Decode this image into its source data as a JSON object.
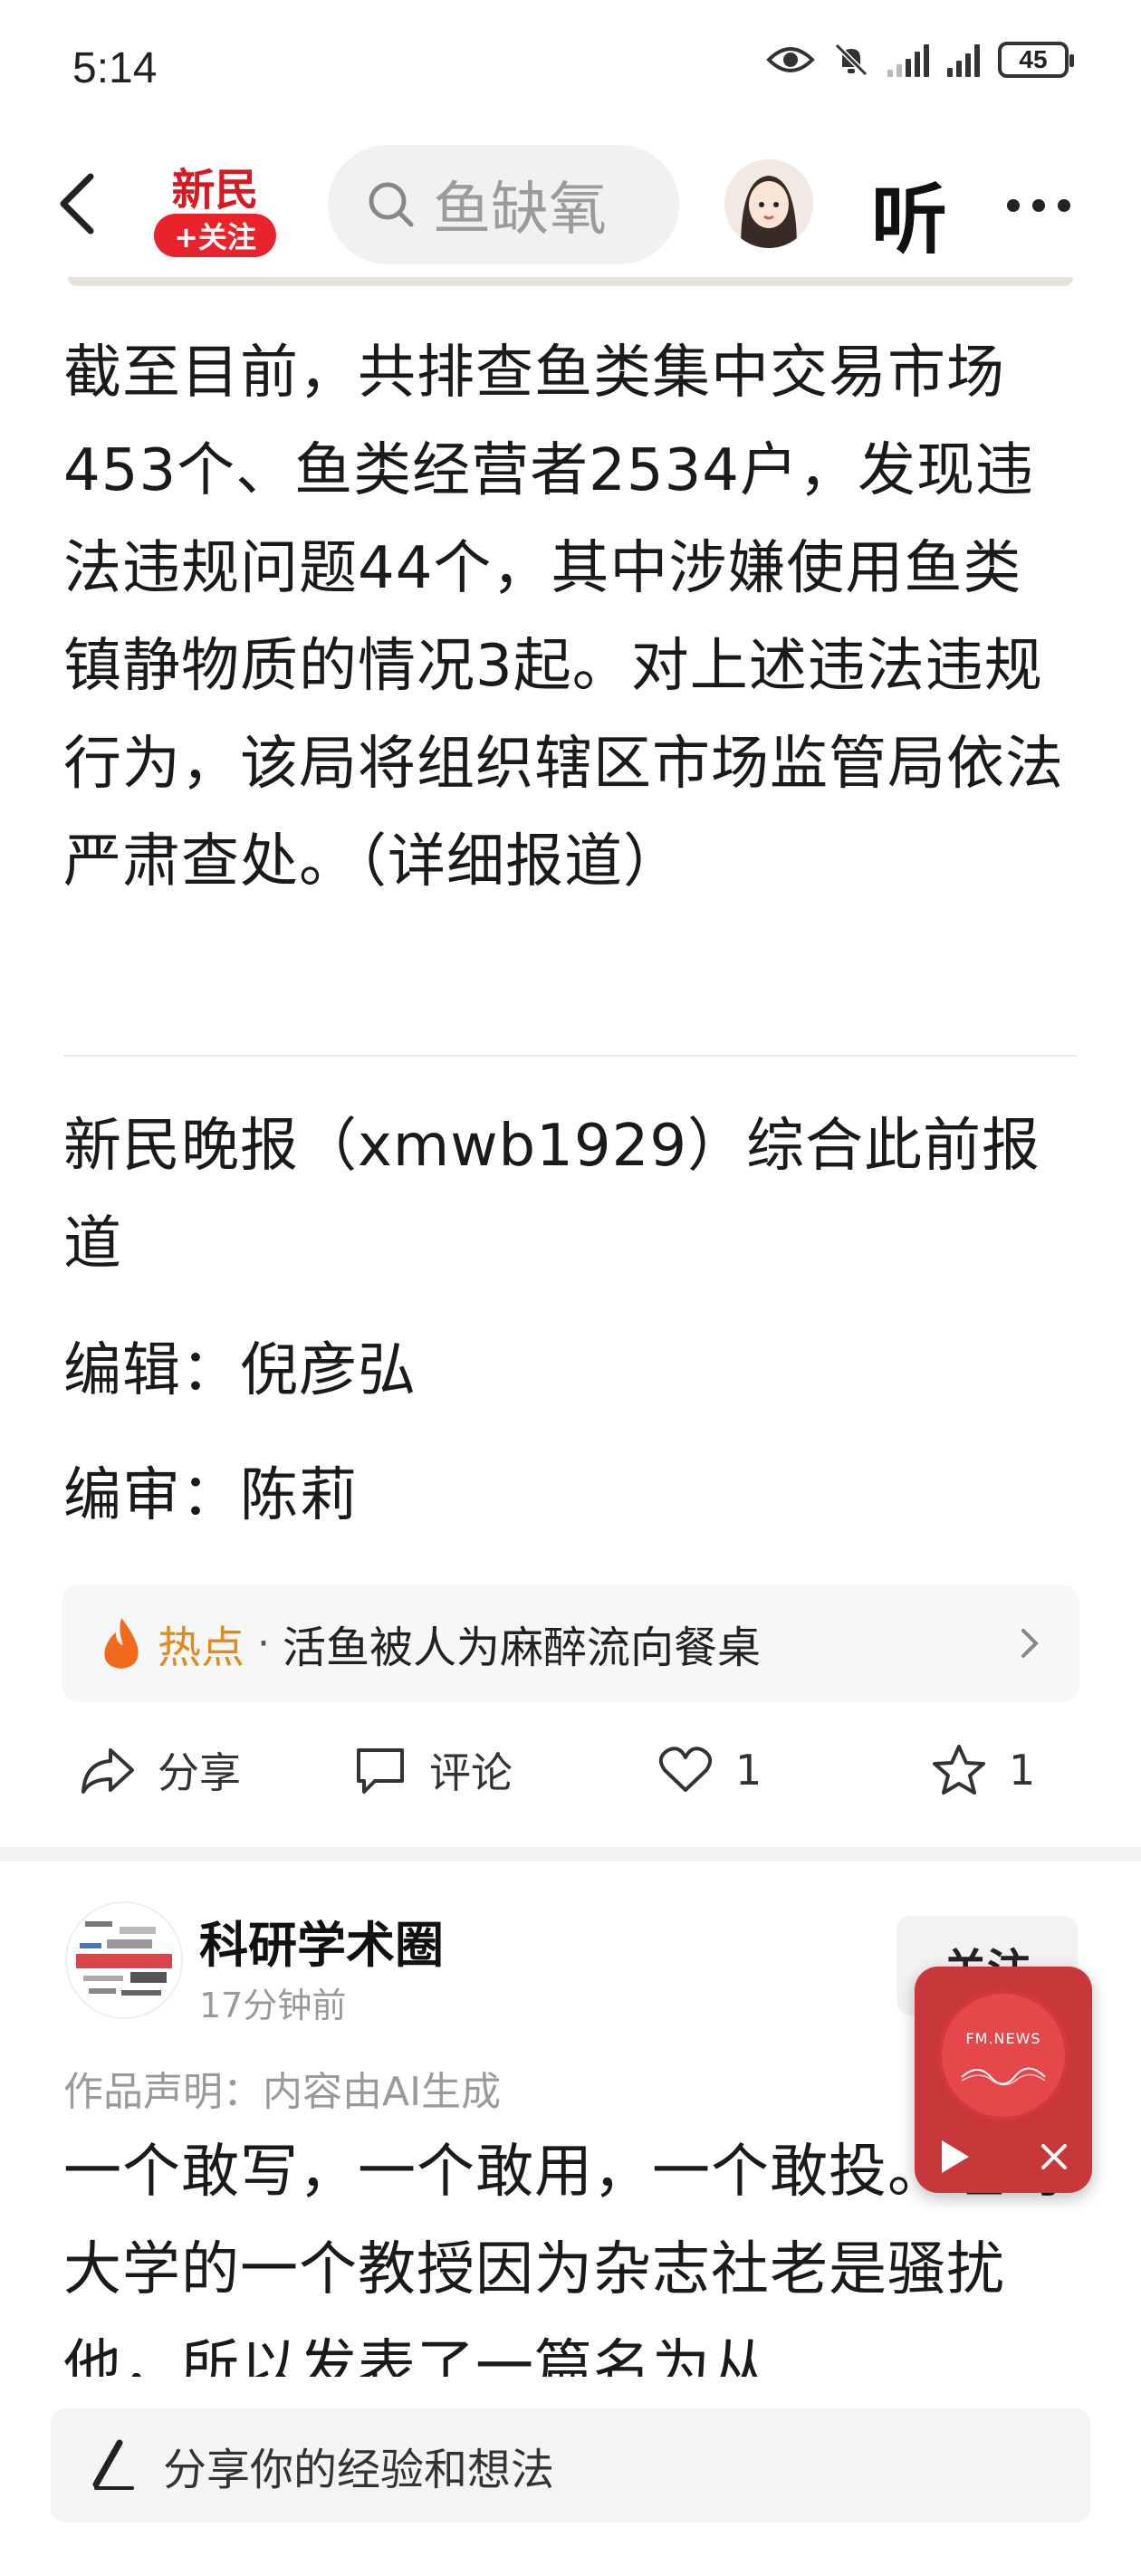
{
  "status_bar": {
    "time": "5:14",
    "battery": "45"
  },
  "header": {
    "logo_text": "新民",
    "follow_label": "+关注",
    "search_text": "鱼缺氧",
    "listen_label": "听"
  },
  "article": {
    "paragraph": "截至目前，共排查鱼类集中交易市场453个、鱼类经营者2534户，发现违法违规问题44个，其中涉嫌使用鱼类镇静物质的情况3起。对上述违法违规行为，该局将组织辖区市场监管局依法严肃查处。（详细报道）",
    "source": "新民晚报（xmwb1929）综合此前报道",
    "editor": "编辑：倪彦弘",
    "reviewer": "编审：陈莉"
  },
  "hot_topic": {
    "label": "热点",
    "separator": "·",
    "title": "活鱼被人为麻醉流向餐桌"
  },
  "actions": {
    "share_label": "分享",
    "comment_label": "评论",
    "like_count": "1",
    "favorite_count": "1"
  },
  "next_post": {
    "author": "科研学术圈",
    "time": "17分钟前",
    "follow_label": "关注",
    "declaration": "作品声明：内容由AI生成",
    "text": "一个敢写，一个敢用，一个敢投。纽约大学的一个教授因为杂志社老是骚扰他，所以发表了一篇名为从"
  },
  "player": {
    "label": "FM.NEWS"
  },
  "comment_bar": {
    "placeholder": "分享你的经验和想法"
  },
  "colors": {
    "brand_red": "#e8232b",
    "hot_orange": "#e38a1e",
    "player_red": "#c8383a"
  }
}
